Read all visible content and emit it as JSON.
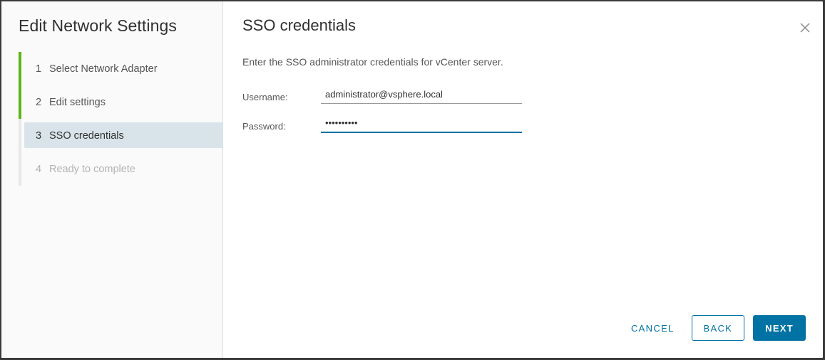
{
  "wizard": {
    "title": "Edit Network Settings",
    "steps": [
      {
        "num": "1",
        "label": "Select Network Adapter",
        "state": "done"
      },
      {
        "num": "2",
        "label": "Edit settings",
        "state": "done"
      },
      {
        "num": "3",
        "label": "SSO credentials",
        "state": "active"
      },
      {
        "num": "4",
        "label": "Ready to complete",
        "state": "disabled"
      }
    ]
  },
  "page": {
    "title": "SSO credentials",
    "description": "Enter the SSO administrator credentials for vCenter server.",
    "username_label": "Username:",
    "username_value": "administrator@vsphere.local",
    "password_label": "Password:",
    "password_value": "••••••••••"
  },
  "footer": {
    "cancel_label": "CANCEL",
    "back_label": "BACK",
    "next_label": "NEXT"
  },
  "icons": {
    "close": "close-icon"
  },
  "colors": {
    "accent": "#0072a3",
    "done": "#60b515",
    "active_step_bg": "#d9e4ea"
  }
}
